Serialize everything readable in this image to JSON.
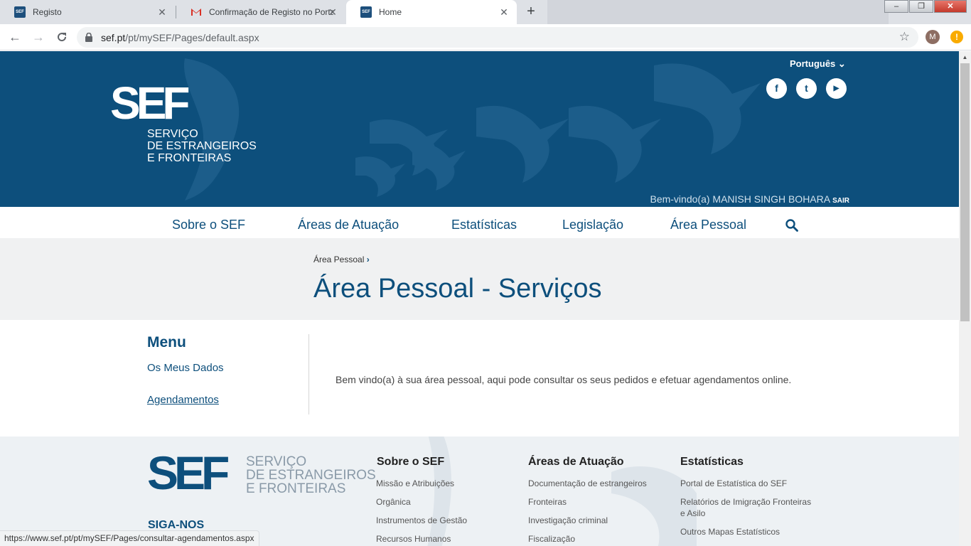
{
  "browser": {
    "tabs": [
      {
        "title": "Registo",
        "active": false
      },
      {
        "title": "Confirmação de Registo no Porta",
        "active": false
      },
      {
        "title": "Home",
        "active": true
      }
    ],
    "url_host": "sef.pt",
    "url_path": "/pt/mySEF/Pages/default.aspx",
    "profile_initial": "M",
    "alert_glyph": "!",
    "status_url": "https://www.sef.pt/pt/mySEF/Pages/consultar-agendamentos.aspx"
  },
  "header": {
    "logo_text": "SEF",
    "logo_lines": [
      "SERVIÇO",
      "DE ESTRANGEIROS",
      "E FRONTEIRAS"
    ],
    "language": "Português",
    "social": [
      {
        "name": "facebook-icon",
        "glyph": "f"
      },
      {
        "name": "twitter-icon",
        "glyph": "t"
      },
      {
        "name": "youtube-icon",
        "glyph": "▶"
      }
    ],
    "welcome": "Bem-vindo(a) MANISH SINGH BOHARA",
    "logout": "SAIR"
  },
  "nav": {
    "items": [
      "Sobre o SEF",
      "Áreas de Atuação",
      "Estatísticas",
      "Legislação",
      "Área Pessoal"
    ]
  },
  "title_band": {
    "breadcrumb": "Área Pessoal",
    "title": "Área Pessoal - Serviços"
  },
  "sidemenu": {
    "heading": "Menu",
    "items": [
      "Os Meus Dados",
      "Agendamentos"
    ]
  },
  "main": {
    "message": "Bem vindo(a) à sua área pessoal, aqui pode consultar os seus pedidos e efetuar agendamentos online."
  },
  "footer": {
    "logo_text": "SEF",
    "logo_lines": [
      "SERVIÇO",
      "DE ESTRANGEIROS",
      "E FRONTEIRAS"
    ],
    "follow": "SIGA-NOS",
    "columns": [
      {
        "title": "Sobre o SEF",
        "links": [
          "Missão e Atribuições",
          "Orgânica",
          "Instrumentos de Gestão",
          "Recursos Humanos"
        ]
      },
      {
        "title": "Áreas de Atuação",
        "links": [
          "Documentação de estrangeiros",
          "Fronteiras",
          "Investigação criminal",
          "Fiscalização"
        ]
      },
      {
        "title": "Estatísticas",
        "links": [
          "Portal de Estatística do SEF",
          "Relatórios de Imigração Fronteiras e Asilo",
          "Outros Mapas Estatísticos"
        ]
      }
    ]
  },
  "colors": {
    "brand": "#0d4f7c",
    "band": "#f0f1f2",
    "footer": "#edf1f4"
  }
}
